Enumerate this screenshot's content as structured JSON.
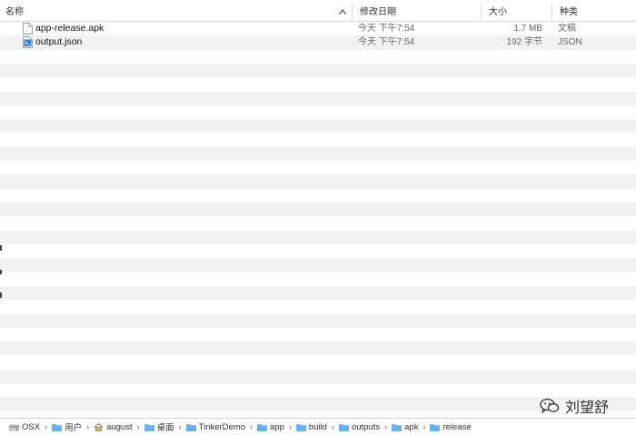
{
  "columns": {
    "name": "名称",
    "date_modified": "修改日期",
    "size": "大小",
    "kind": "种类"
  },
  "files": [
    {
      "name": "app-release.apk",
      "date_modified": "今天 下午7:54",
      "size": "1.7 MB",
      "kind": "文稿",
      "icon": "document-icon"
    },
    {
      "name": "output.json",
      "date_modified": "今天 下午7:54",
      "size": "192 字节",
      "kind": "JSON",
      "icon": "vscode-json-icon"
    }
  ],
  "path_bar": [
    {
      "label": "OSX",
      "icon": "hard-disk-icon"
    },
    {
      "label": "用户",
      "icon": "folder-icon"
    },
    {
      "label": "august",
      "icon": "home-icon"
    },
    {
      "label": "桌面",
      "icon": "folder-icon"
    },
    {
      "label": "TinkerDemo",
      "icon": "folder-icon"
    },
    {
      "label": "app",
      "icon": "folder-icon"
    },
    {
      "label": "build",
      "icon": "folder-icon"
    },
    {
      "label": "outputs",
      "icon": "folder-icon"
    },
    {
      "label": "apk",
      "icon": "folder-icon"
    },
    {
      "label": "release",
      "icon": "folder-icon"
    }
  ],
  "watermark": {
    "text": "刘望舒",
    "icon": "wechat-icon"
  },
  "colors": {
    "folder": "#62b0f0",
    "stripe": "#f2f2f2",
    "border": "#d8d8d8"
  }
}
